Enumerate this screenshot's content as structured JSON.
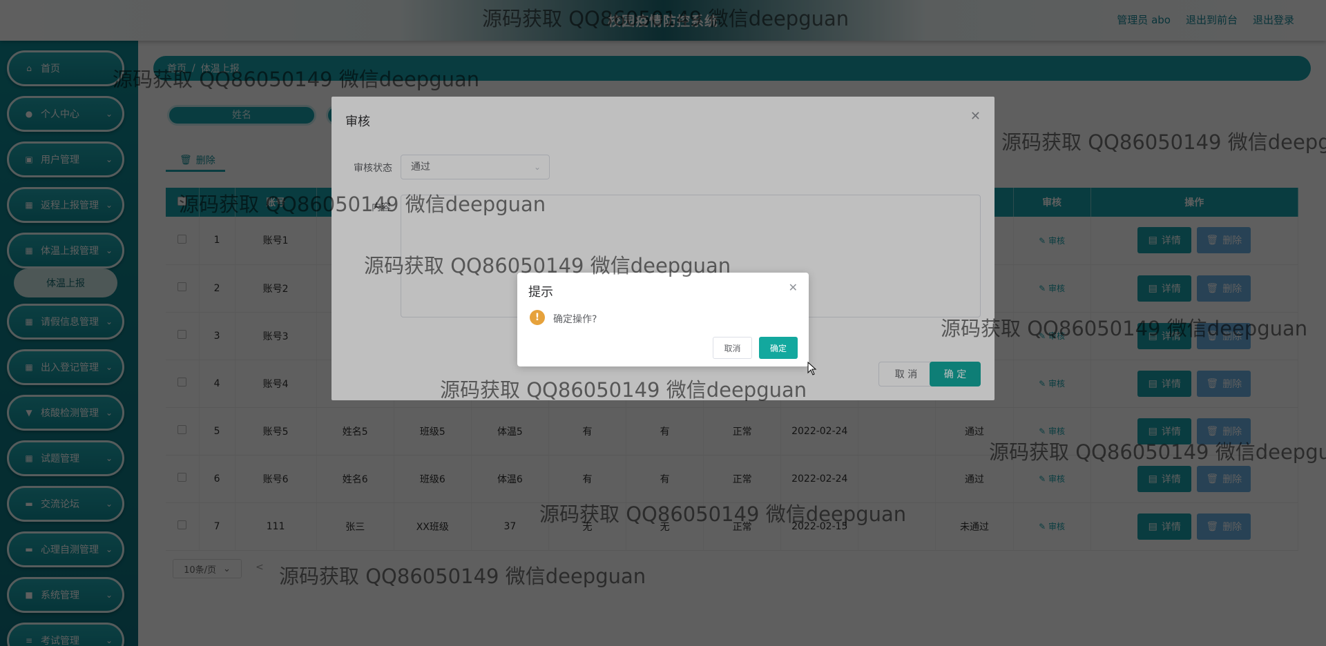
{
  "header": {
    "app_title": "校园疫情防控系统",
    "admin_label": "管理员 abo",
    "to_front_label": "退出到前台",
    "logout_label": "退出登录"
  },
  "sidebar": {
    "items": [
      {
        "label": "首页",
        "icon": "home-icon",
        "has_children": false
      },
      {
        "label": "个人中心",
        "icon": "user-icon",
        "has_children": true
      },
      {
        "label": "用户管理",
        "icon": "id-card-icon",
        "has_children": true
      },
      {
        "label": "返程上报管理",
        "icon": "grid-icon",
        "has_children": true
      },
      {
        "label": "体温上报管理",
        "icon": "grid-icon",
        "has_children": true,
        "expanded": true,
        "children": [
          {
            "label": "体温上报"
          }
        ]
      },
      {
        "label": "请假信息管理",
        "icon": "grid-icon",
        "has_children": true
      },
      {
        "label": "出入登记管理",
        "icon": "grid-icon",
        "has_children": true
      },
      {
        "label": "核酸检测管理",
        "icon": "pin-icon",
        "has_children": true
      },
      {
        "label": "试题管理",
        "icon": "grid-icon",
        "has_children": true
      },
      {
        "label": "交流论坛",
        "icon": "chat-icon",
        "has_children": true
      },
      {
        "label": "心理自测管理",
        "icon": "chat-icon",
        "has_children": true
      },
      {
        "label": "系统管理",
        "icon": "briefcase-icon",
        "has_children": true
      },
      {
        "label": "考试管理",
        "icon": "list-icon",
        "has_children": true
      }
    ]
  },
  "breadcrumb": {
    "home": "首页",
    "sep": "/",
    "current": "体温上报"
  },
  "search": {
    "name_placeholder": "姓名"
  },
  "toolbar": {
    "delete_label": "删除",
    "delete_icon": "trash-icon"
  },
  "table": {
    "visible_headers": {
      "col1": "账号",
      "audit": "审核",
      "ops": "操作"
    },
    "rows": [
      {
        "idx": "1",
        "account": "账号1",
        "name": "",
        "class": "",
        "temp": "",
        "a": "",
        "b": "",
        "status": "",
        "date": "",
        "audit_state": ""
      },
      {
        "idx": "2",
        "account": "账号2",
        "name": "",
        "class": "",
        "temp": "",
        "a": "",
        "b": "",
        "status": "",
        "date": "",
        "audit_state": ""
      },
      {
        "idx": "3",
        "account": "账号3",
        "name": "",
        "class": "",
        "temp": "",
        "a": "",
        "b": "",
        "status": "",
        "date": "",
        "audit_state": ""
      },
      {
        "idx": "4",
        "account": "账号4",
        "name": "",
        "class": "",
        "temp": "",
        "a": "",
        "b": "",
        "status": "",
        "date": "",
        "audit_state": ""
      },
      {
        "idx": "5",
        "account": "账号5",
        "name": "姓名5",
        "class": "班级5",
        "temp": "体温5",
        "a": "有",
        "b": "有",
        "status": "正常",
        "date": "2022-02-24",
        "audit_state": "通过"
      },
      {
        "idx": "6",
        "account": "账号6",
        "name": "姓名6",
        "class": "班级6",
        "temp": "体温6",
        "a": "有",
        "b": "有",
        "status": "正常",
        "date": "2022-02-24",
        "audit_state": "通过"
      },
      {
        "idx": "7",
        "account": "111",
        "name": "张三",
        "class": "XX班级",
        "temp": "37",
        "a": "无",
        "b": "无",
        "status": "正常",
        "date": "2022-02-15",
        "audit_state": "未通过"
      }
    ],
    "audit_link_label": "审核",
    "detail_label": "详情",
    "delete_label": "删除"
  },
  "pagination": {
    "page_size": "10条/页",
    "prev": "<"
  },
  "audit_dialog": {
    "title": "审核",
    "status_label": "审核状态",
    "status_value": "通过",
    "content_label": "内容",
    "cancel_label": "取 消",
    "ok_label": "确 定"
  },
  "confirm_box": {
    "title": "提示",
    "message": "确定操作?",
    "cancel_label": "取消",
    "ok_label": "确定"
  },
  "watermark": "源码获取 QQ86050149 微信deepguan",
  "colors": {
    "primary": "#1aa3ad",
    "sidebar": "#0f7f8a",
    "ok_button": "#13a89e",
    "warning": "#e6a23c",
    "delete_button": "#6cb1e4"
  }
}
